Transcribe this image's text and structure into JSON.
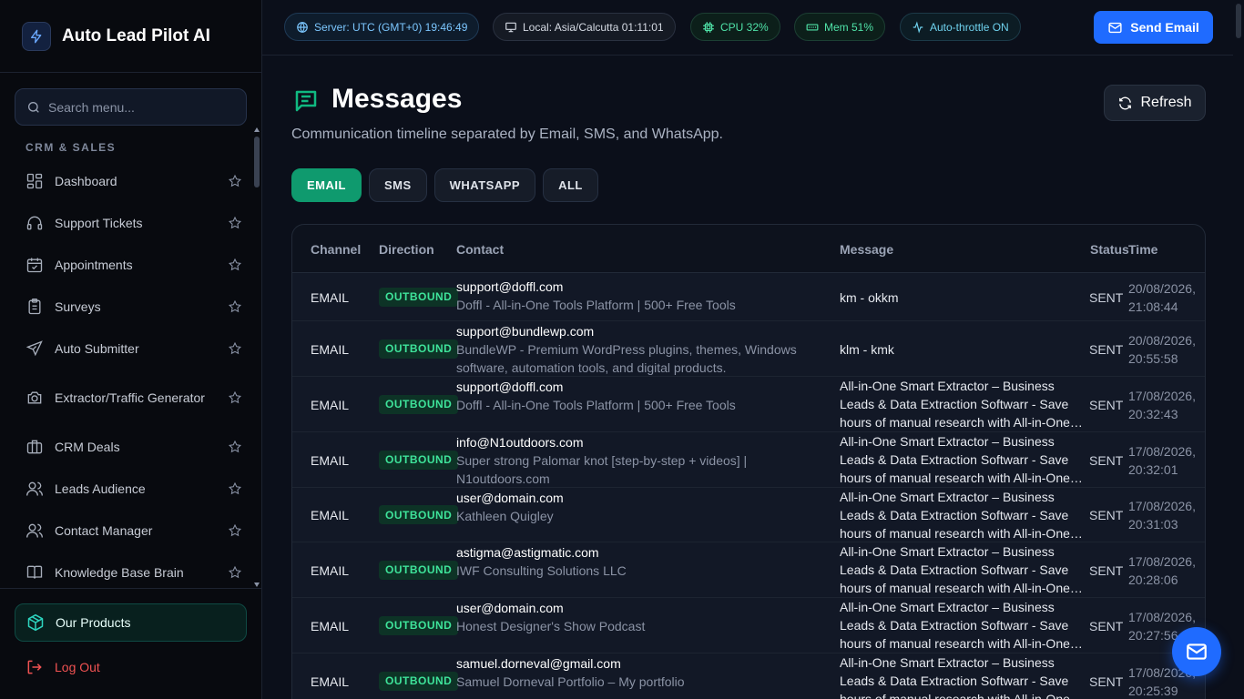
{
  "brand": {
    "title": "Auto Lead Pilot AI"
  },
  "sidebar": {
    "search_placeholder": "Search menu...",
    "section_label": "CRM & SALES",
    "items": [
      {
        "label": "Dashboard",
        "icon": "dashboard-icon"
      },
      {
        "label": "Support Tickets",
        "icon": "headset-icon"
      },
      {
        "label": "Appointments",
        "icon": "calendar-icon"
      },
      {
        "label": "Surveys",
        "icon": "clipboard-icon"
      },
      {
        "label": "Auto Submitter",
        "icon": "send-icon"
      },
      {
        "label": "Extractor/Traffic Generator",
        "icon": "camera-icon"
      },
      {
        "label": "CRM Deals",
        "icon": "briefcase-icon"
      },
      {
        "label": "Leads Audience",
        "icon": "users-icon"
      },
      {
        "label": "Contact Manager",
        "icon": "users-icon"
      },
      {
        "label": "Knowledge Base Brain",
        "icon": "book-icon"
      }
    ],
    "products_label": "Our Products",
    "logout_label": "Log Out"
  },
  "topbar": {
    "server": "Server: UTC (GMT+0) 19:46:49",
    "local": "Local: Asia/Calcutta 01:11:01",
    "cpu": "CPU 32%",
    "mem": "Mem 51%",
    "throttle": "Auto-throttle ON",
    "send_label": "Send Email"
  },
  "page": {
    "title": "Messages",
    "subtitle": "Communication timeline separated by Email, SMS, and WhatsApp.",
    "refresh_label": "Refresh",
    "tabs": [
      {
        "label": "EMAIL",
        "active": true
      },
      {
        "label": "SMS",
        "active": false
      },
      {
        "label": "WHATSAPP",
        "active": false
      },
      {
        "label": "ALL",
        "active": false
      }
    ]
  },
  "table": {
    "columns": [
      "Channel",
      "Direction",
      "Contact",
      "Message",
      "Status",
      "Time"
    ],
    "rows": [
      {
        "channel": "EMAIL",
        "direction": "OUTBOUND",
        "email": "support@doffl.com",
        "site": "Doffl - All-in-One Tools Platform | 500+ Free Tools",
        "message": "km - okkm",
        "status": "SENT",
        "date": "20/08/2026,",
        "time": "21:08:44"
      },
      {
        "channel": "EMAIL",
        "direction": "OUTBOUND",
        "email": "support@bundlewp.com",
        "site": "BundleWP - Premium WordPress plugins, themes, Windows software, automation tools, and digital products.",
        "message": "klm - kmk",
        "status": "SENT",
        "date": "20/08/2026,",
        "time": "20:55:58"
      },
      {
        "channel": "EMAIL",
        "direction": "OUTBOUND",
        "email": "support@doffl.com",
        "site": "Doffl - All-in-One Tools Platform | 500+ Free Tools",
        "message": "All-in-One Smart Extractor – Business Leads & Data Extraction Softwarr - Save hours of manual research with All-in-One Smart Extractor",
        "status": "SENT",
        "date": "17/08/2026,",
        "time": "20:32:43"
      },
      {
        "channel": "EMAIL",
        "direction": "OUTBOUND",
        "email": "info@N1outdoors.com",
        "site": "Super strong Palomar knot [step-by-step + videos] | N1outdoors.com",
        "message": "All-in-One Smart Extractor – Business Leads & Data Extraction Softwarr - Save hours of manual research with All-in-One Smart Extractor",
        "status": "SENT",
        "date": "17/08/2026,",
        "time": "20:32:01"
      },
      {
        "channel": "EMAIL",
        "direction": "OUTBOUND",
        "email": "user@domain.com",
        "site": "Kathleen Quigley",
        "message": "All-in-One Smart Extractor – Business Leads & Data Extraction Softwarr - Save hours of manual research with All-in-One Smart Extractor",
        "status": "SENT",
        "date": "17/08/2026,",
        "time": "20:31:03"
      },
      {
        "channel": "EMAIL",
        "direction": "OUTBOUND",
        "email": "astigma@astigmatic.com",
        "site": "IWF Consulting Solutions LLC",
        "message": "All-in-One Smart Extractor – Business Leads & Data Extraction Softwarr - Save hours of manual research with All-in-One Smart Extractor",
        "status": "SENT",
        "date": "17/08/2026,",
        "time": "20:28:06"
      },
      {
        "channel": "EMAIL",
        "direction": "OUTBOUND",
        "email": "user@domain.com",
        "site": "Honest Designer's Show Podcast",
        "message": "All-in-One Smart Extractor – Business Leads & Data Extraction Softwarr - Save hours of manual research with All-in-One Smart Extractor",
        "status": "SENT",
        "date": "17/08/2026,",
        "time": "20:27:56"
      },
      {
        "channel": "EMAIL",
        "direction": "OUTBOUND",
        "email": "samuel.dorneval@gmail.com",
        "site": "Samuel Dorneval Portfolio – My portfolio",
        "message": "All-in-One Smart Extractor – Business Leads & Data Extraction Softwarr - Save hours of manual research with All-in-One Smart Extractor",
        "status": "SENT",
        "date": "17/08/2026,",
        "time": "20:25:39"
      }
    ]
  },
  "colors": {
    "accent": "#1f6bff",
    "active_tab": "#0f9a6e",
    "outbound": "#3ee39a",
    "logout": "#f05252"
  }
}
